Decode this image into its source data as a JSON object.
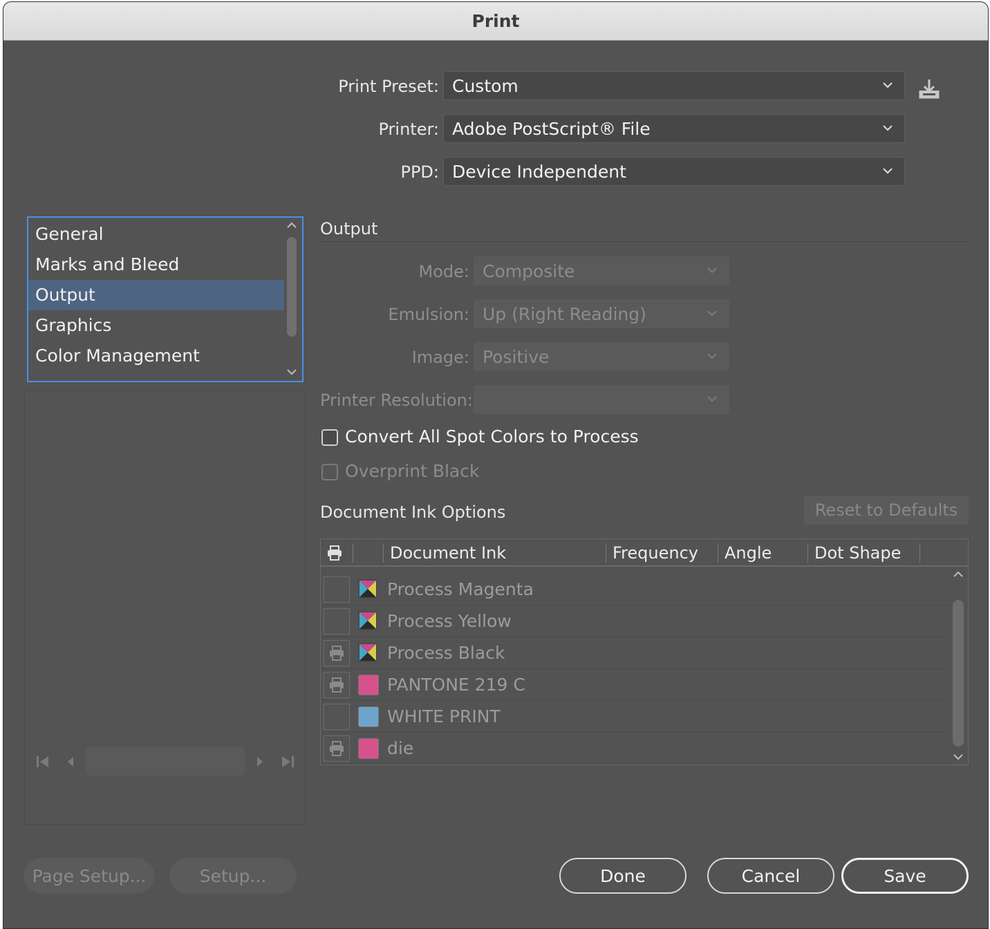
{
  "window": {
    "title": "Print"
  },
  "top": {
    "preset": {
      "label": "Print Preset:",
      "value": "Custom"
    },
    "printer": {
      "label": "Printer:",
      "value": "Adobe PostScript® File"
    },
    "ppd": {
      "label": "PPD:",
      "value": "Device Independent"
    }
  },
  "categories": [
    "General",
    "Marks and Bleed",
    "Output",
    "Graphics",
    "Color Management"
  ],
  "selected_category": "Output",
  "output": {
    "title": "Output",
    "mode": {
      "label": "Mode:",
      "value": "Composite"
    },
    "emulsion": {
      "label": "Emulsion:",
      "value": "Up (Right Reading)"
    },
    "image": {
      "label": "Image:",
      "value": "Positive"
    },
    "resolution": {
      "label": "Printer Resolution:",
      "value": ""
    },
    "convert_spot": {
      "label": "Convert All Spot Colors to Process",
      "checked": false
    },
    "overprint_black": {
      "label": "Overprint Black",
      "checked": false
    }
  },
  "ink_options": {
    "title": "Document Ink Options",
    "reset_label": "Reset to Defaults",
    "columns": [
      "Document Ink",
      "Frequency",
      "Angle",
      "Dot Shape"
    ],
    "rows": [
      {
        "name": "Process Magenta",
        "print": false,
        "swatch": "process"
      },
      {
        "name": "Process Yellow",
        "print": false,
        "swatch": "process"
      },
      {
        "name": "Process Black",
        "print": true,
        "swatch": "process"
      },
      {
        "name": "PANTONE 219 C",
        "print": true,
        "swatch": "#d6528a"
      },
      {
        "name": "WHITE PRINT",
        "print": false,
        "swatch": "#6fa4cc"
      },
      {
        "name": "die",
        "print": true,
        "swatch": "#d6528a"
      }
    ]
  },
  "buttons": {
    "page_setup": "Page Setup...",
    "setup": "Setup...",
    "done": "Done",
    "cancel": "Cancel",
    "save": "Save"
  }
}
